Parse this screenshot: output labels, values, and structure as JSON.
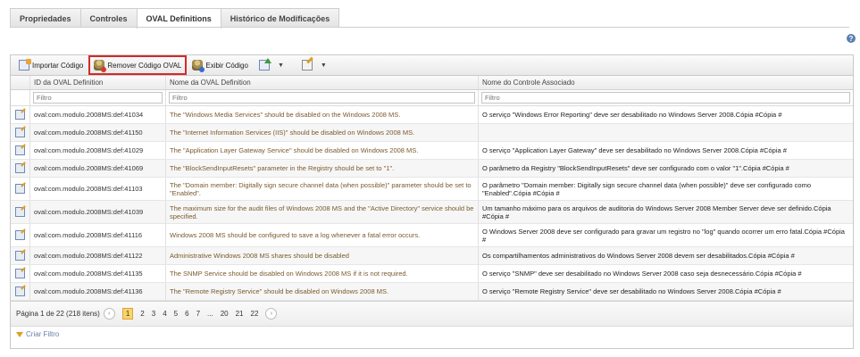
{
  "tabs": [
    {
      "label": "Propriedades"
    },
    {
      "label": "Controles"
    },
    {
      "label": "OVAL Definitions"
    },
    {
      "label": "Histórico de Modificações"
    }
  ],
  "toolbar": {
    "import_label": "Importar Código",
    "remove_label": "Remover Código OVAL",
    "view_label": "Exibir Código"
  },
  "columns": {
    "id": "ID da OVAL Definition",
    "name": "Nome da OVAL Definition",
    "control": "Nome do Controle Associado"
  },
  "filter_placeholder": "Filtro",
  "rows": [
    {
      "id": "oval:com.modulo.2008MS:def:41034",
      "name": "The \"Windows Media Services\" should be disabled on the Windows 2008 MS.",
      "control": "O serviço \"Windows Error Reporting\" deve ser desabilitado no Windows Server 2008.Cópia #Cópia #"
    },
    {
      "id": "oval:com.modulo.2008MS:def:41150",
      "name": "The \"Internet Information Services (IIS)\" should be disabled on Windows 2008 MS.",
      "control": ""
    },
    {
      "id": "oval:com.modulo.2008MS:def:41029",
      "name": "The \"Application Layer Gateway Service\" should be disabled on Windows 2008 MS.",
      "control": "O serviço \"Application Layer Gateway\" deve ser desabilitado no Windows Server 2008.Cópia #Cópia #"
    },
    {
      "id": "oval:com.modulo.2008MS:def:41069",
      "name": "The \"BlockSendInputResets\" parameter in the Registry should be set to \"1\".",
      "control": "O parâmetro da Registry \"BlockSendInputResets\" deve ser configurado com o valor \"1\".Cópia #Cópia #"
    },
    {
      "id": "oval:com.modulo.2008MS:def:41103",
      "name": "The \"Domain member: Digitally sign secure channel data (when possible)\" parameter should be set to \"Enabled\".",
      "control": "O parâmetro \"Domain member: Digitally sign secure channel data (when possible)\" deve ser configurado como \"Enabled\".Cópia #Cópia #"
    },
    {
      "id": "oval:com.modulo.2008MS:def:41039",
      "name": "The maximum size for the audit files of Windows 2008 MS and the \"Active Directory\" service should be specified.",
      "control": "Um tamanho máximo para os arquivos de auditoria do Windows Server 2008 Member Server deve ser definido.Cópia #Cópia #"
    },
    {
      "id": "oval:com.modulo.2008MS:def:41116",
      "name": "Windows 2008 MS should be configured to save a log whenever a fatal error occurs.",
      "control": "O Windows Server 2008 deve ser configurado para gravar um registro no \"log\" quando ocorrer um erro fatal.Cópia #Cópia #"
    },
    {
      "id": "oval:com.modulo.2008MS:def:41122",
      "name": "Administrative Windows 2008 MS shares should be disabled",
      "control": "Os compartilhamentos administrativos do Windows Server 2008 devem ser desabilitados.Cópia #Cópia #"
    },
    {
      "id": "oval:com.modulo.2008MS:def:41135",
      "name": "The SNMP Service should be disabled on Windows 2008 MS if it is not required.",
      "control": "O serviço \"SNMP\" deve ser desabilitado no Windows Server 2008 caso seja desnecessário.Cópia #Cópia #"
    },
    {
      "id": "oval:com.modulo.2008MS:def:41136",
      "name": "The \"Remote Registry Service\" should be disabled on Windows 2008 MS.",
      "control": "O serviço \"Remote Registry Service\" deve ser desabilitado no Windows Server 2008.Cópia #Cópia #"
    }
  ],
  "pager": {
    "summary": "Página 1 de 22 (218 itens)",
    "pages": [
      "1",
      "2",
      "3",
      "4",
      "5",
      "6",
      "7",
      "...",
      "20",
      "21",
      "22"
    ],
    "current": "1"
  },
  "create_filter_label": "Criar Filtro",
  "help_label": "?"
}
